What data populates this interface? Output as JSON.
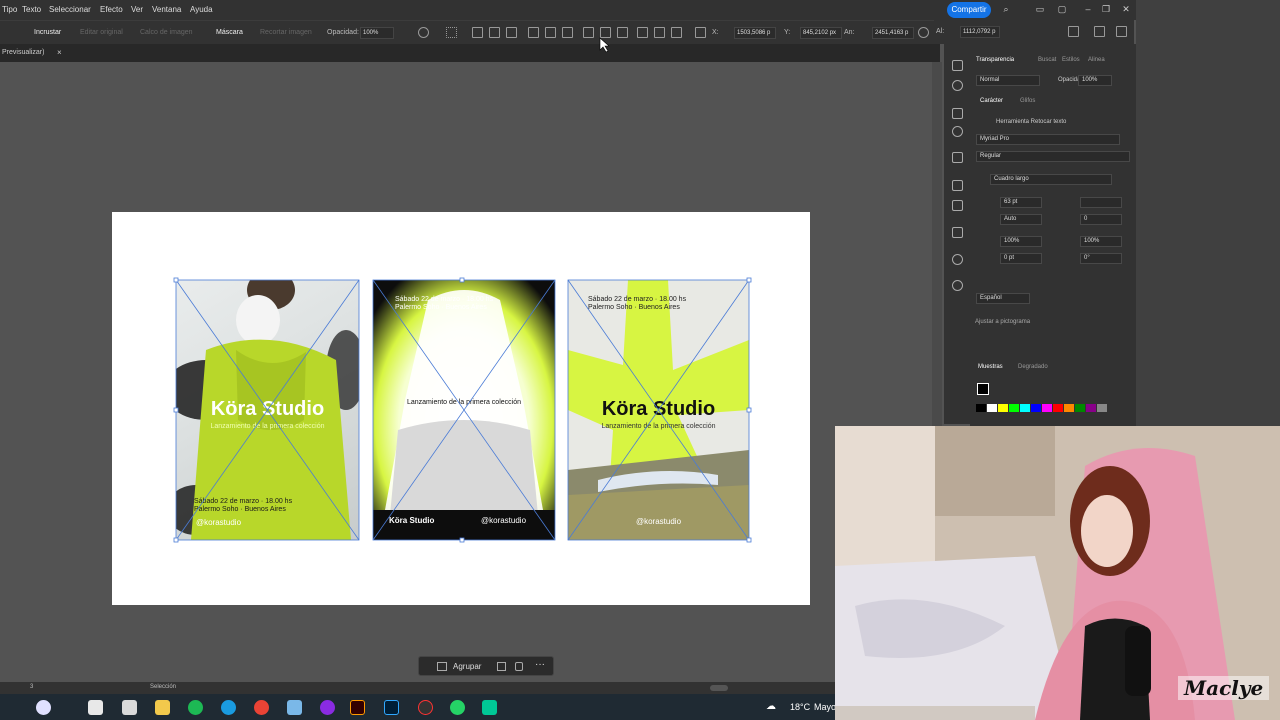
{
  "menubar": {
    "items": [
      "Tipo",
      "Texto",
      "Seleccionar",
      "Efecto",
      "Ver",
      "Ventana",
      "Ayuda"
    ],
    "share_label": "Compartir"
  },
  "controlbar": {
    "embed": "Incrustar",
    "edit_original": "Editar original",
    "image_trace": "Calco de imagen",
    "mask": "Máscara",
    "crop": "Recortar imagen",
    "opacity_label": "Opacidad:",
    "opacity_value": "100%",
    "x_label": "X:",
    "x_value": "1503,5086 p",
    "y_label": "Y:",
    "y_value": "845,2102 px",
    "w_label": "An:",
    "w_value": "2451,4163 p",
    "h_label": "Al:",
    "h_value": "1112,0792 p"
  },
  "tab": {
    "label": "Previsualizar)"
  },
  "posters": [
    {
      "title": "Köra Studio",
      "subtitle": "Lanzamiento de la primera colección",
      "date": "Sábado 22 de marzo · 18.00 hs",
      "place": "Palermo Soho · Buenos Aires",
      "handle": "@korastudio"
    },
    {
      "date": "Sábado 22 de marzo · 18.00 hs",
      "place": "Palermo Soho · Buenos Aires",
      "subtitle": "Lanzamiento de la primera colección",
      "title": "Köra Studio",
      "handle": "@korastudio"
    },
    {
      "date": "Sábado 22 de marzo · 18.00 hs",
      "place": "Palermo Soho · Buenos Aires",
      "title": "Köra Studio",
      "subtitle": "Lanzamiento de la primera colección",
      "handle": "@korastudio"
    }
  ],
  "panel": {
    "tabs1": [
      "Transparencia",
      "Buscat",
      "Estilos",
      "Alinea"
    ],
    "blend": "Normal",
    "opacity_label": "Opacidad:",
    "opacity_value": "100%",
    "tabs2": [
      "Carácter",
      "Glifos"
    ],
    "touch_tool": "Herramienta Retocar texto",
    "font": "Myriad Pro",
    "style": "Regular",
    "size_mode": "Cuadro largo",
    "font_size": "63 pt",
    "leading": "Auto",
    "kerning": "Auto",
    "tracking": "0",
    "vscale": "100%",
    "hscale": "100%",
    "baseline": "0 pt",
    "rotation": "0°",
    "language": "Español",
    "align_label": "Ajustar a pictograma",
    "tabs3": [
      "Muestras",
      "Degradado"
    ],
    "swatch_colors": [
      "#000000",
      "#ffffff",
      "#ffff00",
      "#00ff00",
      "#00ffff",
      "#0000ff",
      "#ff00ff",
      "#ff0000",
      "#ff8800",
      "#008800",
      "#880088",
      "#888888"
    ]
  },
  "statusbar": {
    "zoom": "3",
    "tool": "Selección"
  },
  "context": {
    "group": "Agrupar"
  },
  "taskbar": {
    "weather": "18°C",
    "weather_desc": "Mayo"
  },
  "webcam": {
    "watermark": "Maclye"
  },
  "colors": {
    "accent": "#1473e6",
    "lime": "#d7f542",
    "selection": "#4a7bd6"
  }
}
